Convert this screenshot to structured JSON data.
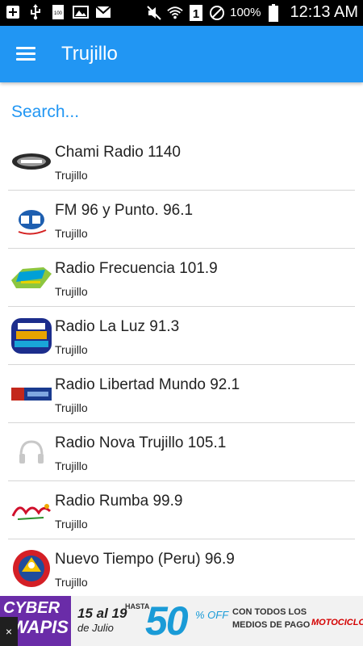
{
  "status_bar": {
    "battery_percent": "100%",
    "time": "12:13 AM",
    "sim_indicator": "1",
    "badge_100": "100"
  },
  "app_bar": {
    "title": "Trujillo"
  },
  "search": {
    "placeholder": "Search..."
  },
  "stations": [
    {
      "name": "Chami Radio 1140",
      "city": "Trujillo"
    },
    {
      "name": "FM 96 y Punto. 96.1",
      "city": "Trujillo"
    },
    {
      "name": "Radio Frecuencia 101.9",
      "city": "Trujillo"
    },
    {
      "name": "Radio La Luz 91.3",
      "city": "Trujillo"
    },
    {
      "name": "Radio Libertad Mundo 92.1",
      "city": "Trujillo"
    },
    {
      "name": "Radio Nova Trujillo 105.1",
      "city": "Trujillo"
    },
    {
      "name": "Radio Rumba 99.9",
      "city": "Trujillo"
    },
    {
      "name": "Nuevo Tiempo (Peru) 96.9",
      "city": "Trujillo"
    }
  ],
  "ad": {
    "brand_line1": "CYBER",
    "brand_line2": "WAPIS",
    "dates": "15 al 19",
    "month": "de Julio",
    "hasta": "HASTA",
    "discount": "50",
    "off": "% OFF",
    "copy_line1": "CON TODOS LOS",
    "copy_line2": "MEDIOS DE PAGO",
    "sponsor": "MOTOCICLO",
    "close_glyph": "×"
  },
  "colors": {
    "primary": "#2196f3",
    "status_bar": "#000000",
    "text": "#222222",
    "divider": "#d6d6d6"
  }
}
